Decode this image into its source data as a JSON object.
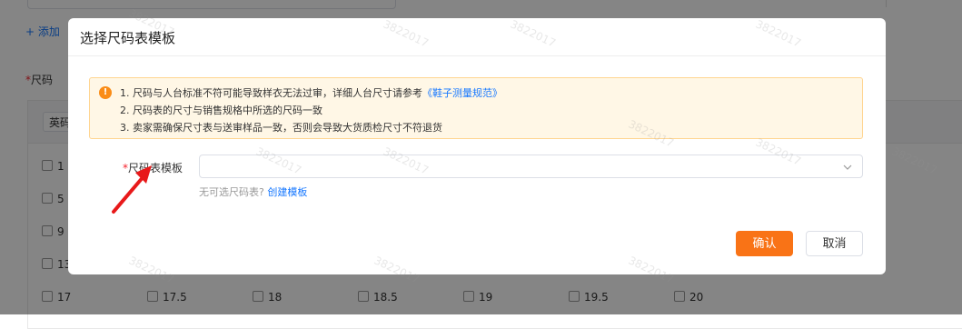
{
  "background": {
    "add_link": "+ 添加",
    "size_label_star": "*",
    "size_label": "尺码",
    "unit_select": "英码",
    "sizes_row1": [
      "1"
    ],
    "sizes_col": [
      "5",
      "9",
      "13"
    ],
    "sizes_bottom": [
      "17",
      "17.5",
      "18",
      "18.5",
      "19",
      "19.5",
      "20"
    ]
  },
  "modal": {
    "title": "选择尺码表模板",
    "alert": {
      "icon": "!",
      "line1_text": "1. 尺码与人台标准不符可能导致样衣无法过审，详细人台尺寸请参考",
      "line1_link": "《鞋子测量规范》",
      "line2": "2. 尺码表的尺寸与销售规格中所选的尺码一致",
      "line3": "3. 卖家需确保尺寸表与送审样品一致，否则会导致大货质检尺寸不符退货"
    },
    "form": {
      "star": "*",
      "label": "尺码表模板",
      "select_value": "",
      "hint_text": "无可选尺码表?",
      "hint_link": "创建模板"
    },
    "buttons": {
      "confirm": "确认",
      "cancel": "取消"
    }
  },
  "watermark_text": "3822017",
  "colors": {
    "accent": "#f97316",
    "link": "#1677ff",
    "warning": "#fa8c16",
    "alert_bg": "#fff7e6",
    "arrow": "#e8191a"
  }
}
